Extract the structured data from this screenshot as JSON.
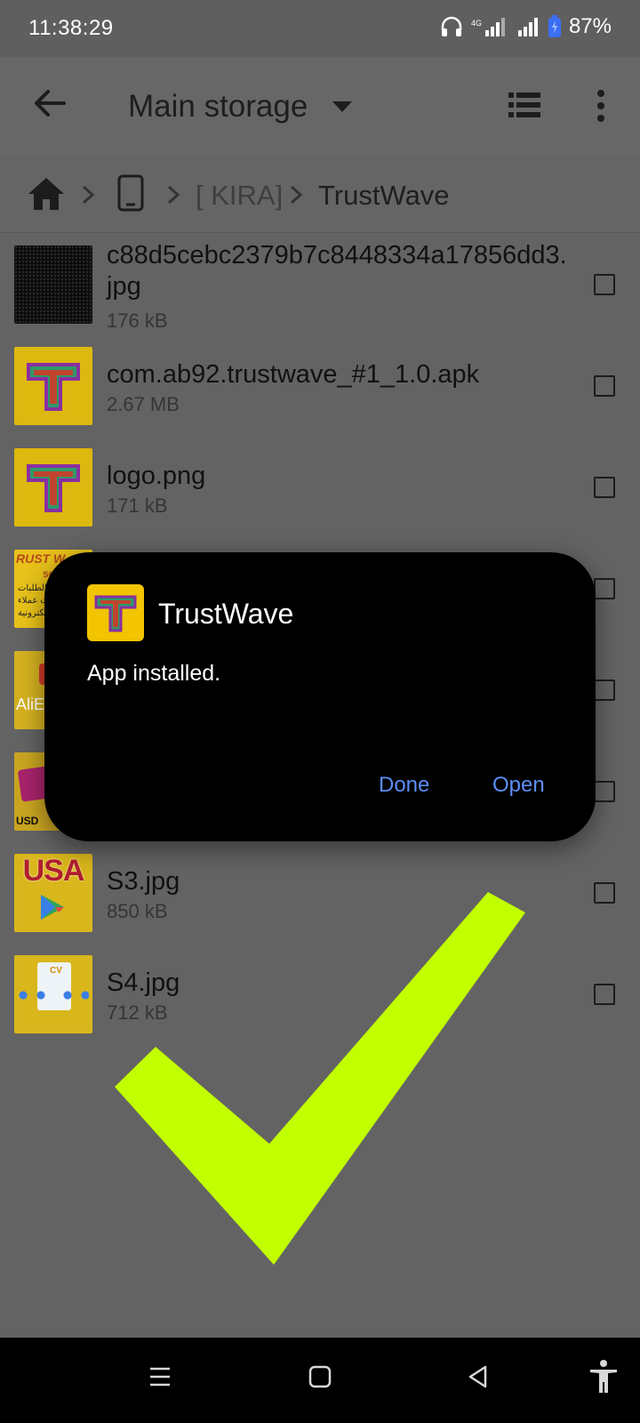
{
  "status": {
    "time": "11:38:29",
    "network": "4G",
    "battery": "87%"
  },
  "appbar": {
    "title": "Main storage"
  },
  "breadcrumb": {
    "folder1": "[ KIRA]",
    "folder2": "TrustWave"
  },
  "files": [
    {
      "name": "c88d5cebc2379b7c8448334a17856dd3.jpg",
      "size": "176 kB"
    },
    {
      "name": "com.ab92.trustwave_#1_1.0.apk",
      "size": "2.67 MB"
    },
    {
      "name": "logo.png",
      "size": "171 kB"
    },
    {
      "name": "S3.jpg",
      "size": "850 kB"
    },
    {
      "name": "S4.jpg",
      "size": "712 kB"
    }
  ],
  "dialog": {
    "app_name": "TrustWave",
    "message": "App installed.",
    "done_label": "Done",
    "open_label": "Open"
  },
  "thumb_text": {
    "usa": "USA",
    "aliexpress": "AliEx",
    "usd": "USD",
    "cv": "CV",
    "rust": "RUST W",
    "serv": "serv",
    "arabic_line1": "لتنفيذ الطلبات",
    "arabic_line2": "حسابات عملاء",
    "arabic_line3": "الالكترونية"
  },
  "colors": {
    "dialog_bg": "#000000",
    "dialog_button": "#5d8ef7",
    "checkmark": "#c2ff00",
    "scrim_bg": "#636363"
  }
}
